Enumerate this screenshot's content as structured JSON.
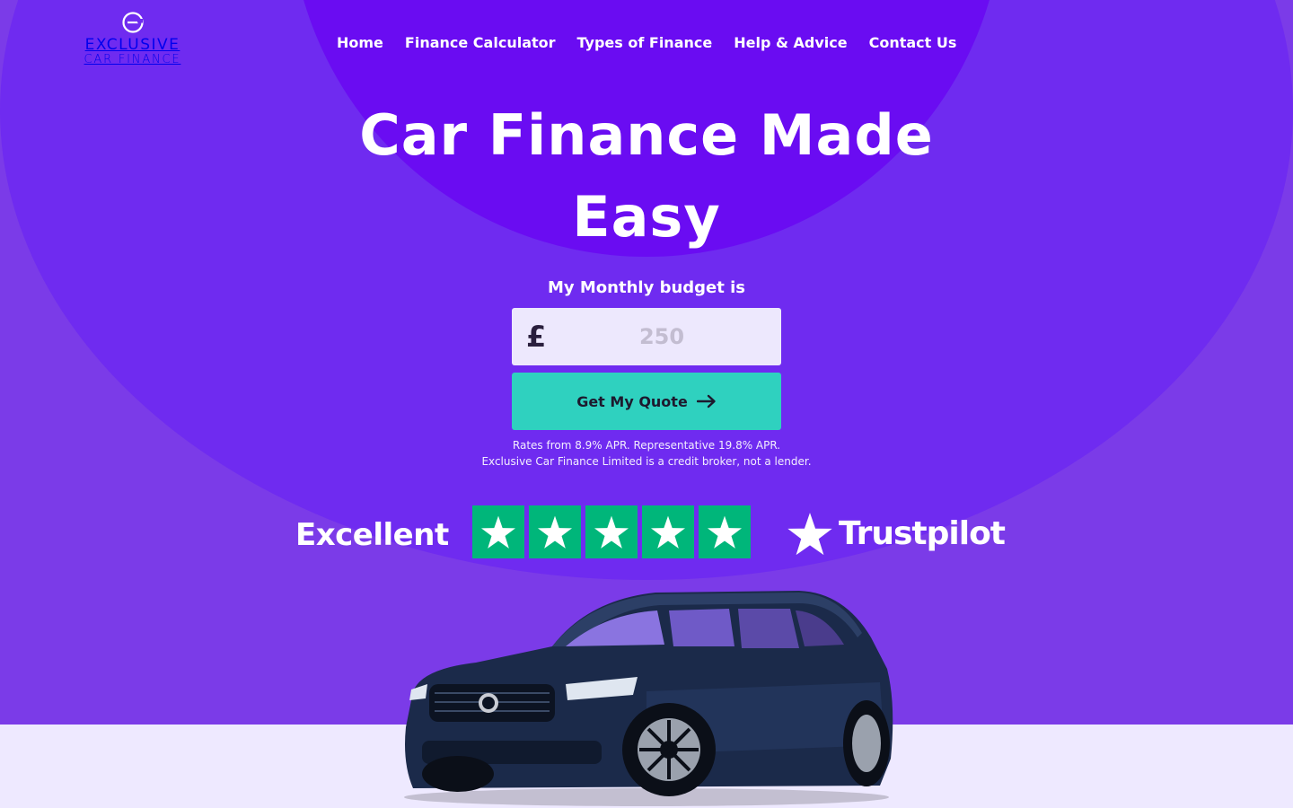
{
  "brand": {
    "logo_line1": "EXCLUSIVE",
    "logo_line2": "CAR FINANCE"
  },
  "nav": {
    "items": [
      {
        "label": "Home"
      },
      {
        "label": "Finance Calculator"
      },
      {
        "label": "Types of Finance"
      },
      {
        "label": "Help & Advice"
      },
      {
        "label": "Contact Us"
      }
    ]
  },
  "hero": {
    "title": "Car Finance Made Easy",
    "budget_label": "My Monthly budget is",
    "currency_symbol": "£",
    "budget_placeholder": "250",
    "budget_value": "",
    "cta_label": "Get My Quote",
    "disclaimer_line1": "Rates from 8.9% APR. Representative 19.8% APR.",
    "disclaimer_line2": "Exclusive Car Finance Limited is a credit broker, not a lender."
  },
  "trustpilot": {
    "rating_text": "Excellent",
    "stars": 5,
    "brand": "Trustpilot"
  },
  "colors": {
    "primary_purple": "#6a0cf2",
    "cta_teal": "#2fd1bf",
    "trustpilot_green": "#00b67a",
    "lower_band": "#eee9ff"
  }
}
